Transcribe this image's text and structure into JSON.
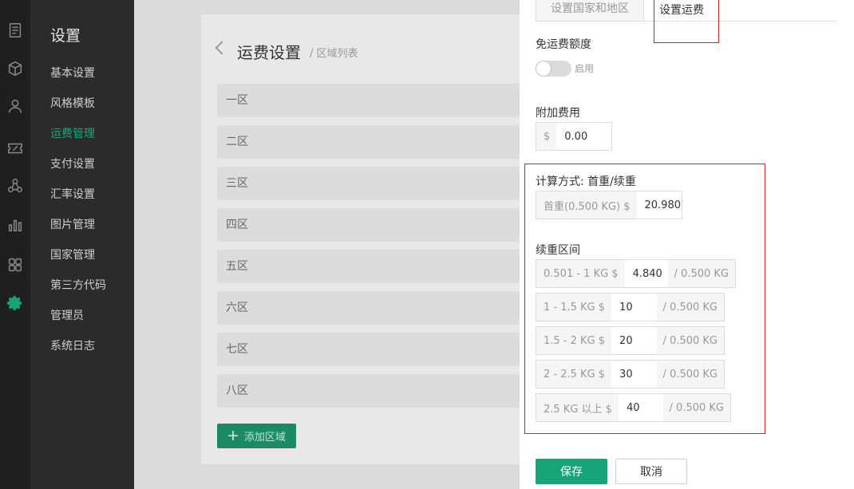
{
  "rail": {
    "icons": [
      "document-icon",
      "cube-icon",
      "users-icon",
      "percent-icon",
      "network-icon",
      "bar-chart-icon",
      "apps-icon",
      "gear-icon"
    ]
  },
  "sidebar": {
    "title": "设置",
    "items": [
      {
        "label": "基本设置"
      },
      {
        "label": "风格模板"
      },
      {
        "label": "运费管理",
        "active": true
      },
      {
        "label": "支付设置"
      },
      {
        "label": "汇率设置"
      },
      {
        "label": "图片管理"
      },
      {
        "label": "国家管理"
      },
      {
        "label": "第三方代码"
      },
      {
        "label": "管理员"
      },
      {
        "label": "系统日志"
      }
    ]
  },
  "main": {
    "title": "运费设置",
    "subtitle": "/ 区域列表",
    "zones": [
      "一区",
      "二区",
      "三区",
      "四区",
      "五区",
      "六区",
      "七区",
      "八区"
    ],
    "add_button": "添加区域"
  },
  "panel": {
    "tabs": [
      "设置国家和地区",
      "设置运费"
    ],
    "free_shipping_label": "免运费额度",
    "toggle_label": "启用",
    "extra_fee_label": "附加费用",
    "extra_fee_prefix": "$",
    "extra_fee_value": "0.00",
    "calc_label": "计算方式: 首重/续重",
    "first_weight_prefix": "首重(0.500 KG) $",
    "first_weight_value": "20.980",
    "range_label": "续重区间",
    "ranges": [
      {
        "prefix": "0.501 - 1 KG $",
        "value": "4.840",
        "suffix": "/ 0.500 KG"
      },
      {
        "prefix": "1 - 1.5 KG $",
        "value": "10",
        "suffix": "/ 0.500 KG"
      },
      {
        "prefix": "1.5 - 2 KG $",
        "value": "20",
        "suffix": "/ 0.500 KG"
      },
      {
        "prefix": "2 - 2.5 KG $",
        "value": "30",
        "suffix": "/ 0.500 KG"
      },
      {
        "prefix": "2.5 KG 以上 $",
        "value": "40",
        "suffix": "/ 0.500 KG"
      }
    ],
    "save_button": "保存",
    "cancel_button": "取消"
  },
  "colors": {
    "accent": "#16a57a",
    "highlight": "#e31b1b",
    "sidebar_bg": "#2b2b2b",
    "rail_bg": "#1f1f1f"
  }
}
